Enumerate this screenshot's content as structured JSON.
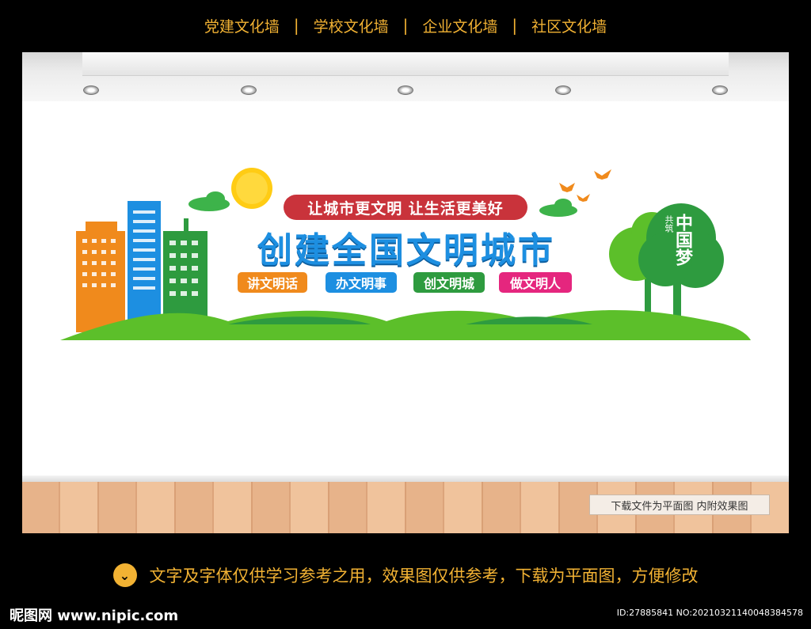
{
  "top_nav": [
    "党建文化墙",
    "学校文化墙",
    "企业文化墙",
    "社区文化墙"
  ],
  "separator": "|",
  "banner": {
    "slogan": "让城市更文明  让生活更美好",
    "title": "创建全国文明城市",
    "tags": [
      {
        "label": "讲文明话",
        "color": "#f08a1c"
      },
      {
        "label": "办文明事",
        "color": "#1d8fe1"
      },
      {
        "label": "创文明城",
        "color": "#2e9b3f"
      },
      {
        "label": "做文明人",
        "color": "#e5267e"
      }
    ],
    "tree_text_small": "共筑",
    "tree_text_big": "中国梦"
  },
  "colors": {
    "accent": "#f2b233",
    "title_blue": "#1d8fe1",
    "slogan_red": "#c9333b",
    "grass": "#5cbf2a"
  },
  "preview_note": "下载文件为平面图  内附效果图",
  "bottom_note": "文字及字体仅供学习参考之用，效果图仅供参考，下载为平面图，方便修改",
  "down_icon": "chevron-down-icon",
  "watermark_logo": "昵图网 www.nipic.com",
  "watermark_id": "ID:27885841 NO:20210321140048384578"
}
